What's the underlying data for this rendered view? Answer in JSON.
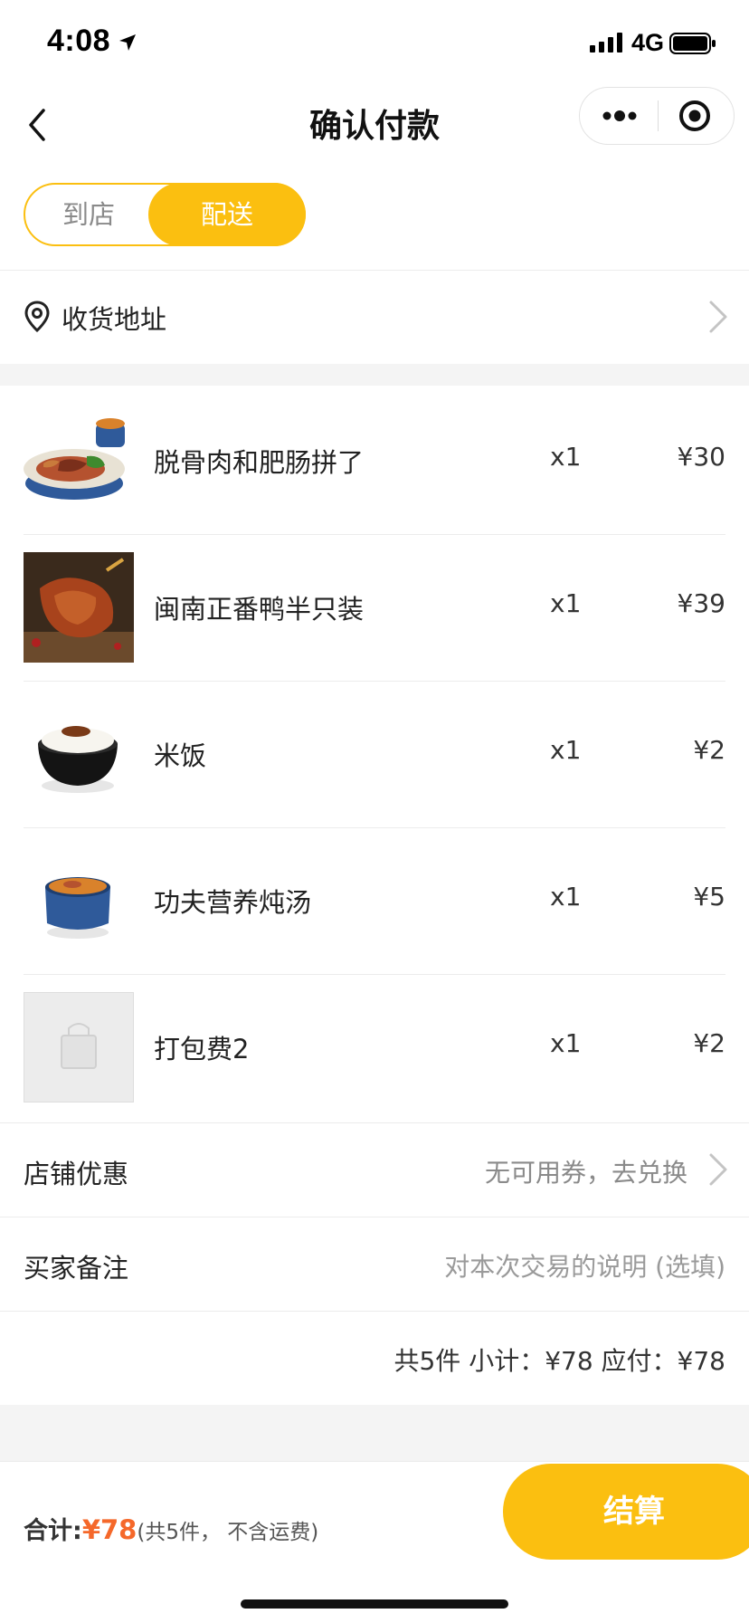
{
  "status_bar": {
    "time": "4:08",
    "network": "4G"
  },
  "nav": {
    "title": "确认付款"
  },
  "mode_toggle": {
    "store": "到店",
    "delivery": "配送",
    "selected": "配送"
  },
  "address": {
    "label": "收货地址"
  },
  "items": [
    {
      "name": "脱骨肉和肥肠拼了",
      "qty": "x1",
      "price": "¥30",
      "image": "duck-platter-photo"
    },
    {
      "name": "闽南正番鸭半只装",
      "qty": "x1",
      "price": "¥39",
      "image": "roast-duck-photo"
    },
    {
      "name": "米饭",
      "qty": "x1",
      "price": "¥2",
      "image": "rice-bowl-photo"
    },
    {
      "name": "功夫营养炖汤",
      "qty": "x1",
      "price": "¥5",
      "image": "soup-pot-photo"
    },
    {
      "name": "打包费2",
      "qty": "x1",
      "price": "¥2",
      "image": "bag-placeholder"
    }
  ],
  "store_discount": {
    "label": "店铺优惠",
    "value": "无可用券，去兑换"
  },
  "buyer_note": {
    "label": "买家备注",
    "placeholder": "对本次交易的说明 (选填)"
  },
  "summary": {
    "text": "共5件 小计：¥78 应付：¥78"
  },
  "footer": {
    "total_label": "合计:",
    "total_amount": "¥78",
    "total_note": "(共5件， 不含运费)",
    "checkout_label": "结算"
  },
  "colors": {
    "accent": "#fbbf10",
    "price_highlight": "#f5682a",
    "divider": "#ececec",
    "band": "#f4f4f4"
  }
}
